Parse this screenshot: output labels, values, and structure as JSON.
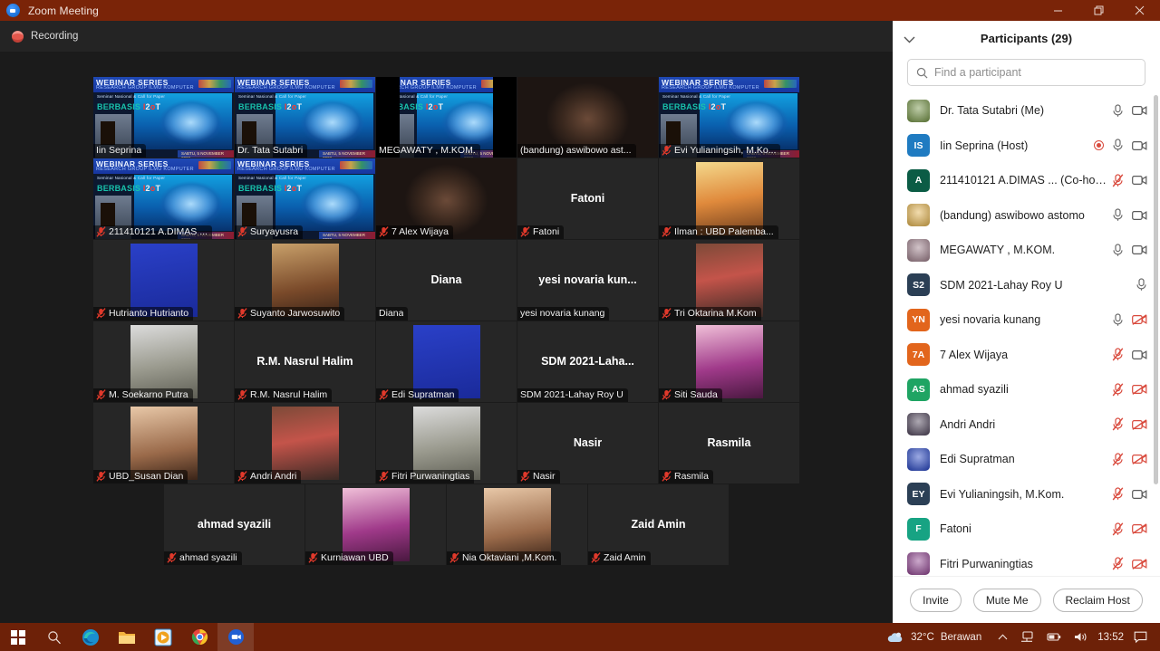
{
  "window": {
    "title": "Zoom Meeting",
    "logo_icon": "zoom-logo-icon",
    "minimize_icon": "minimize-icon",
    "restore_icon": "restore-icon",
    "close_icon": "close-icon"
  },
  "recording": {
    "label": "Recording",
    "icon": "recording-icon"
  },
  "gallery": {
    "active_border_color": "#d9e84a",
    "rows": [
      [
        {
          "name": "Iin Seprina",
          "display": "Iin Seprina",
          "type": "video-webinar",
          "muted": false,
          "active": false,
          "center_name": ""
        },
        {
          "name": "Dr. Tata Sutabri",
          "display": "Dr. Tata Sutabri",
          "type": "video-webinar",
          "muted": false,
          "active": false,
          "center_name": ""
        },
        {
          "name": "MEGAWATY , M.KOM.",
          "display": "MEGAWATY , M.KOM.",
          "type": "video-webinar-dark",
          "muted": false,
          "active": true,
          "center_name": ""
        },
        {
          "name": "(bandung) aswibowo astomo",
          "display": "(bandung) aswibowo ast...",
          "type": "video-plain",
          "muted": false,
          "active": false,
          "center_name": ""
        },
        {
          "name": "Evi Yulianingsih, M.Kom.",
          "display": "Evi Yulianingsih, M.Ko...",
          "type": "video-webinar",
          "muted": true,
          "active": false,
          "center_name": ""
        }
      ],
      [
        {
          "name": "211410121 A.DIMAS",
          "display": "211410121 A.DIMAS ...",
          "type": "video-webinar",
          "muted": true,
          "active": false,
          "center_name": ""
        },
        {
          "name": "Suryayusra",
          "display": "Suryayusra",
          "type": "video-webinar",
          "muted": true,
          "active": false,
          "center_name": ""
        },
        {
          "name": "7 Alex Wijaya",
          "display": "7 Alex Wijaya",
          "type": "video-plain",
          "muted": true,
          "active": false,
          "center_name": ""
        },
        {
          "name": "Fatoni",
          "display": "Fatoni",
          "type": "name-only",
          "muted": true,
          "active": false,
          "center_name": "Fatoni"
        },
        {
          "name": "Ilman : UBD Palembang",
          "display": "Ilman : UBD Palemba...",
          "type": "photo",
          "muted": true,
          "active": false,
          "center_name": ""
        }
      ],
      [
        {
          "name": "Hutrianto Hutrianto",
          "display": "Hutrianto Hutrianto",
          "type": "photo",
          "muted": true,
          "active": false,
          "center_name": ""
        },
        {
          "name": "Suyanto Jarwosuwito",
          "display": "Suyanto Jarwosuwito",
          "type": "photo",
          "muted": true,
          "active": false,
          "center_name": ""
        },
        {
          "name": "Diana",
          "display": "Diana",
          "type": "name-only",
          "muted": false,
          "active": false,
          "center_name": "Diana"
        },
        {
          "name": "yesi novaria kunang",
          "display": "yesi novaria kunang",
          "type": "name-only",
          "muted": false,
          "active": false,
          "center_name": "yesi novaria kun..."
        },
        {
          "name": "Tri Oktarina M.Kom",
          "display": "Tri Oktarina M.Kom",
          "type": "photo",
          "muted": true,
          "active": false,
          "center_name": ""
        }
      ],
      [
        {
          "name": "M. Soekarno Putra",
          "display": "M. Soekarno Putra",
          "type": "photo",
          "muted": true,
          "active": false,
          "center_name": ""
        },
        {
          "name": "R.M. Nasrul Halim",
          "display": "R.M. Nasrul Halim",
          "type": "name-only",
          "muted": true,
          "active": false,
          "center_name": "R.M. Nasrul Halim"
        },
        {
          "name": "Edi Supratman",
          "display": "Edi Supratman",
          "type": "photo",
          "muted": true,
          "active": false,
          "center_name": ""
        },
        {
          "name": "SDM 2021-Lahay Roy U",
          "display": "SDM 2021-Lahay Roy U",
          "type": "name-only",
          "muted": false,
          "active": false,
          "center_name": "SDM 2021-Laha..."
        },
        {
          "name": "Siti Sauda",
          "display": "Siti Sauda",
          "type": "photo",
          "muted": true,
          "active": false,
          "center_name": ""
        }
      ],
      [
        {
          "name": "UBD_Susan Dian",
          "display": "UBD_Susan Dian",
          "type": "photo",
          "muted": true,
          "active": false,
          "center_name": ""
        },
        {
          "name": "Andri Andri",
          "display": "Andri Andri",
          "type": "photo",
          "muted": true,
          "active": false,
          "center_name": ""
        },
        {
          "name": "Fitri Purwaningtias",
          "display": "Fitri Purwaningtias",
          "type": "photo",
          "muted": true,
          "active": false,
          "center_name": ""
        },
        {
          "name": "Nasir",
          "display": "Nasir",
          "type": "name-only",
          "muted": true,
          "active": false,
          "center_name": "Nasir"
        },
        {
          "name": "Rasmila",
          "display": "Rasmila",
          "type": "name-only",
          "muted": true,
          "active": false,
          "center_name": "Rasmila"
        }
      ],
      [
        {
          "name": "ahmad syazili",
          "display": "ahmad syazili",
          "type": "name-only",
          "muted": true,
          "active": false,
          "center_name": "ahmad syazili"
        },
        {
          "name": "Kurniawan UBD",
          "display": "Kurniawan UBD",
          "type": "photo",
          "muted": true,
          "active": false,
          "center_name": ""
        },
        {
          "name": "Nia Oktaviani ,M.Kom.",
          "display": "Nia Oktaviani ,M.Kom.",
          "type": "photo",
          "muted": true,
          "active": false,
          "center_name": ""
        },
        {
          "name": "Zaid Amin",
          "display": "Zaid Amin",
          "type": "name-only",
          "muted": true,
          "active": false,
          "center_name": "Zaid Amin"
        }
      ]
    ]
  },
  "panel": {
    "title": "Participants (29)",
    "collapse_icon": "chevron-down-icon",
    "search": {
      "placeholder": "Find a participant",
      "value": "",
      "icon": "search-icon"
    },
    "participants": [
      {
        "name": "Dr. Tata Sutabri (Me)",
        "initials": "",
        "avatar_color": "#6f8f3f",
        "avatar_type": "photo",
        "mic": "unmuted",
        "video": "on",
        "recording": false
      },
      {
        "name": "Iin Seprina (Host)",
        "initials": "IS",
        "avatar_color": "#1f7bc1",
        "avatar_type": "initials",
        "mic": "unmuted",
        "video": "on",
        "recording": true
      },
      {
        "name": "211410121 A.DIMAS ...  (Co-host)",
        "initials": "A",
        "avatar_color": "#0b5c45",
        "avatar_type": "initials",
        "mic": "muted",
        "video": "on",
        "recording": false
      },
      {
        "name": "(bandung) aswibowo astomo",
        "initials": "",
        "avatar_color": "#e2b14a",
        "avatar_type": "photo",
        "mic": "unmuted",
        "video": "on",
        "recording": false
      },
      {
        "name": "MEGAWATY , M.KOM.",
        "initials": "",
        "avatar_color": "#9a7a86",
        "avatar_type": "photo",
        "mic": "unmuted",
        "video": "on",
        "recording": false
      },
      {
        "name": "SDM 2021-Lahay Roy U",
        "initials": "S2",
        "avatar_color": "#2b3f55",
        "avatar_type": "initials",
        "mic": "unmuted",
        "video": "none",
        "recording": false
      },
      {
        "name": "yesi novaria kunang",
        "initials": "YN",
        "avatar_color": "#e2651c",
        "avatar_type": "initials",
        "mic": "unmuted",
        "video": "off",
        "recording": false
      },
      {
        "name": "7 Alex Wijaya",
        "initials": "7A",
        "avatar_color": "#e2651c",
        "avatar_type": "initials",
        "mic": "muted",
        "video": "on",
        "recording": false
      },
      {
        "name": "ahmad syazili",
        "initials": "AS",
        "avatar_color": "#1fa463",
        "avatar_type": "initials",
        "mic": "muted",
        "video": "off",
        "recording": false
      },
      {
        "name": "Andri Andri",
        "initials": "",
        "avatar_color": "#4a3f55",
        "avatar_type": "photo",
        "mic": "muted",
        "video": "off",
        "recording": false
      },
      {
        "name": "Edi Supratman",
        "initials": "",
        "avatar_color": "#2040c0",
        "avatar_type": "photo",
        "mic": "muted",
        "video": "off",
        "recording": false
      },
      {
        "name": "Evi Yulianingsih, M.Kom.",
        "initials": "EY",
        "avatar_color": "#2b3f55",
        "avatar_type": "initials",
        "mic": "muted",
        "video": "on",
        "recording": false
      },
      {
        "name": "Fatoni",
        "initials": "F",
        "avatar_color": "#17a383",
        "avatar_type": "initials",
        "mic": "muted",
        "video": "off",
        "recording": false
      },
      {
        "name": "Fitri Purwaningtias",
        "initials": "",
        "avatar_color": "#8d3f8d",
        "avatar_type": "photo",
        "mic": "muted",
        "video": "off",
        "recording": false
      }
    ],
    "buttons": {
      "invite": "Invite",
      "mute_me": "Mute Me",
      "reclaim_host": "Reclaim Host"
    }
  },
  "taskbar": {
    "items": [
      {
        "icon": "windows-start-icon",
        "pinned": false
      },
      {
        "icon": "search-icon",
        "pinned": false
      },
      {
        "icon": "edge-icon",
        "pinned": false
      },
      {
        "icon": "file-explorer-icon",
        "pinned": false
      },
      {
        "icon": "media-player-icon",
        "pinned": false
      },
      {
        "icon": "chrome-icon",
        "pinned": false
      },
      {
        "icon": "zoom-icon",
        "pinned": true
      }
    ],
    "tray": {
      "weather_icon": "cloud-icon",
      "temperature": "32°C",
      "condition": "Berawan",
      "chevron_icon": "chevron-up-icon",
      "network_icon": "network-icon",
      "battery_icon": "battery-icon",
      "volume_icon": "volume-icon",
      "time": "13:52",
      "notification_icon": "notification-icon"
    }
  }
}
